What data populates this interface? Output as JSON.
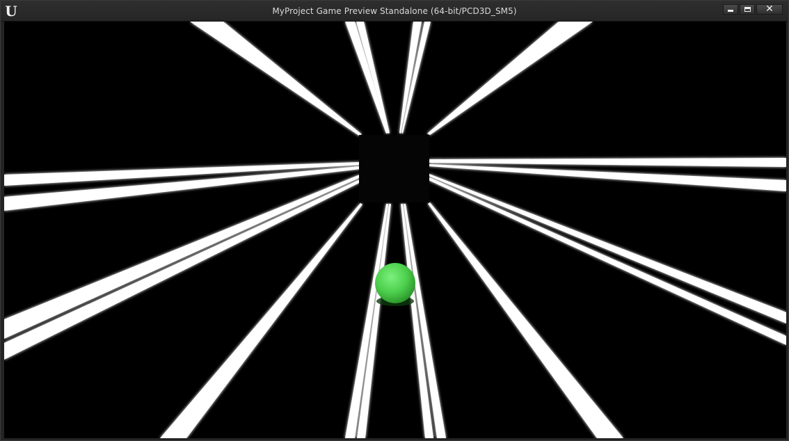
{
  "window": {
    "title": "MyProject Game Preview Standalone (64-bit/PCD3D_SM5)",
    "logo_glyph": "U",
    "logo_icon": "unreal-engine-logo-icon",
    "controls": {
      "minimize_icon": "minimize-icon",
      "maximize_icon": "maximize-icon",
      "close_icon": "close-icon",
      "close_glyph": "✕"
    }
  },
  "scene": {
    "background_color": "#000000",
    "beam_color": "#ffffff",
    "ball_color": "#4ccf4c",
    "ball_icon": "green-ball"
  }
}
